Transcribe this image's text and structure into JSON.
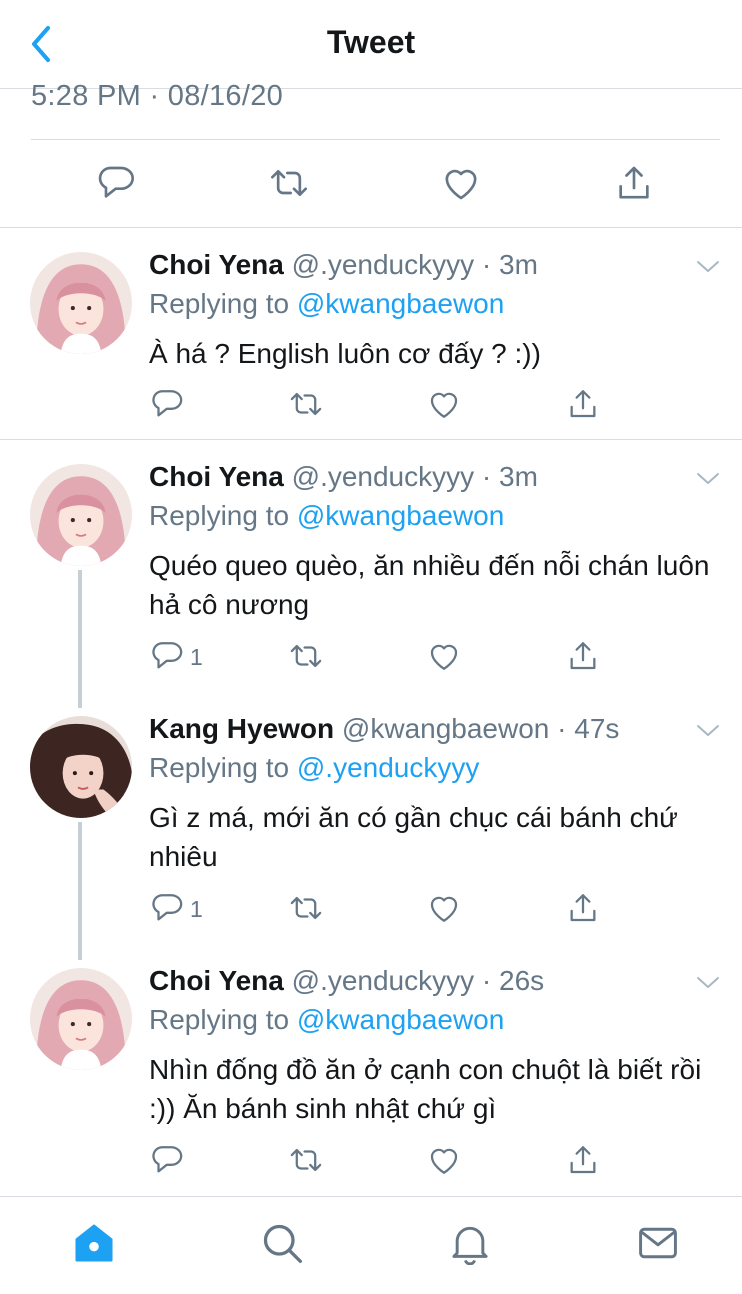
{
  "header": {
    "title": "Tweet",
    "back_icon": "chevron-left-icon"
  },
  "main_tweet": {
    "timestamp": "5:28 PM · 08/16/20",
    "actions": [
      "reply-icon",
      "retweet-icon",
      "like-icon",
      "share-icon"
    ]
  },
  "replies": [
    {
      "name": "Choi Yena",
      "handle": "@.yenduckyyy · 3m",
      "replying_prefix": "Replying to ",
      "replying_to": "@kwangbaewon",
      "text": "À há ? English luôn cơ đấy ? :))",
      "reply_count": ""
    },
    {
      "name": "Choi Yena",
      "handle": "@.yenduckyyy · 3m",
      "replying_prefix": "Replying to ",
      "replying_to": "@kwangbaewon",
      "text": "Quéo queo quèo, ăn nhiều đến nỗi chán luôn hả cô nương",
      "reply_count": "1"
    },
    {
      "name": "Kang Hyewon",
      "handle": "@kwangbaewon · 47s",
      "replying_prefix": "Replying to ",
      "replying_to": "@.yenduckyyy",
      "text": "Gì z má, mới ăn có gần chục cái bánh chứ nhiêu",
      "reply_count": "1"
    },
    {
      "name": "Choi Yena",
      "handle": "@.yenduckyyy · 26s",
      "replying_prefix": "Replying to ",
      "replying_to": "@kwangbaewon",
      "text": "Nhìn đống đồ ăn ở cạnh con chuột là biết rồi :)) Ăn bánh sinh nhật chứ gì",
      "reply_count": ""
    }
  ],
  "tabbar": {
    "items": [
      "home-icon",
      "search-icon",
      "notifications-icon",
      "messages-icon"
    ],
    "active": "home-icon"
  },
  "colors": {
    "accent": "#1da1f2",
    "muted": "#657786",
    "text": "#14171a",
    "divider": "#d9dde1",
    "thread_line": "#c4cfd6"
  }
}
